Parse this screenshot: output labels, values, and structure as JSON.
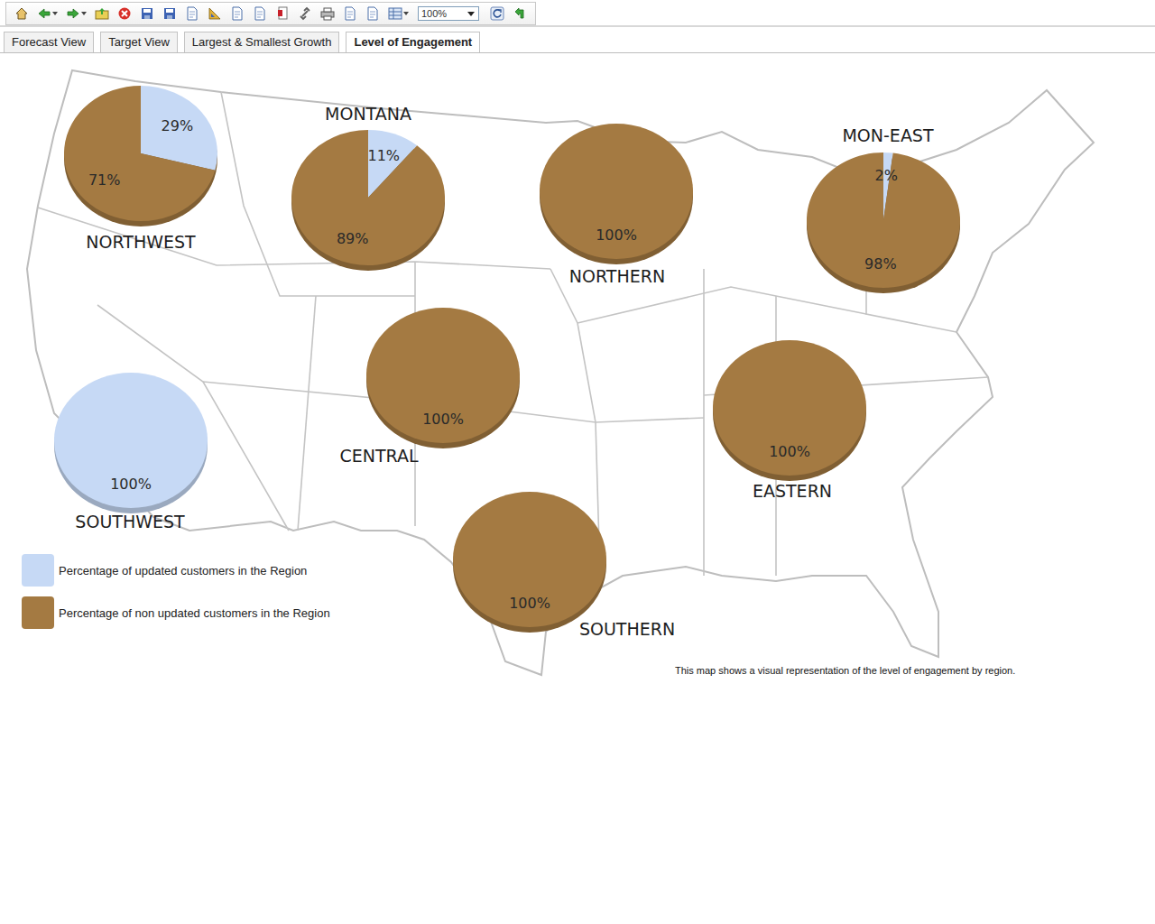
{
  "toolbar": {
    "zoom": "100%"
  },
  "tabs": [
    {
      "label": "Forecast View",
      "selected": false
    },
    {
      "label": "Target View",
      "selected": false
    },
    {
      "label": "Largest & Smallest Growth",
      "selected": false
    },
    {
      "label": "Level of Engagement",
      "selected": true
    }
  ],
  "legend": [
    {
      "key": "updated",
      "label": "Percentage of updated customers in the Region",
      "color": "#c6d9f5"
    },
    {
      "key": "non_updated",
      "label": "Percentage of non updated customers in the Region",
      "color": "#a47a42"
    }
  ],
  "regions": [
    {
      "name": "NORTHWEST",
      "slices": [
        {
          "series": "updated",
          "value": 29,
          "label": "29%"
        },
        {
          "series": "non_updated",
          "value": 71,
          "label": "71%"
        }
      ]
    },
    {
      "name": "MONTANA",
      "slices": [
        {
          "series": "updated",
          "value": 11,
          "label": "11%"
        },
        {
          "series": "non_updated",
          "value": 89,
          "label": "89%"
        }
      ]
    },
    {
      "name": "NORTHERN",
      "slices": [
        {
          "series": "non_updated",
          "value": 100,
          "label": "100%"
        }
      ]
    },
    {
      "name": "MON-EAST",
      "slices": [
        {
          "series": "updated",
          "value": 2,
          "label": "2%"
        },
        {
          "series": "non_updated",
          "value": 98,
          "label": "98%"
        }
      ]
    },
    {
      "name": "CENTRAL",
      "slices": [
        {
          "series": "non_updated",
          "value": 100,
          "label": "100%"
        }
      ]
    },
    {
      "name": "SOUTHWEST",
      "slices": [
        {
          "series": "updated",
          "value": 100,
          "label": "100%"
        }
      ]
    },
    {
      "name": "EASTERN",
      "slices": [
        {
          "series": "non_updated",
          "value": 100,
          "label": "100%"
        }
      ]
    },
    {
      "name": "SOUTHERN",
      "slices": [
        {
          "series": "non_updated",
          "value": 100,
          "label": "100%"
        }
      ]
    }
  ],
  "note": "This map shows a visual representation of the level of engagement by region."
}
